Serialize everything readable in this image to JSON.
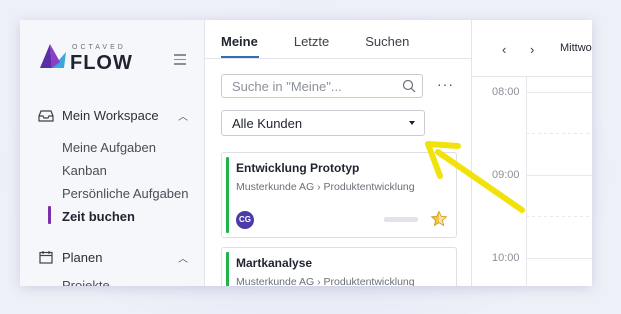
{
  "brand": {
    "tagline": "OCTAVED",
    "name": "FLOW",
    "colors": {
      "accent": "#7b2fa8",
      "logo_left": "#5b2ea6",
      "logo_right": "#3aa7e0"
    }
  },
  "sidebar": {
    "workspace_label": "Mein Workspace",
    "items": [
      {
        "label": "Meine Aufgaben"
      },
      {
        "label": "Kanban"
      },
      {
        "label": "Persönliche Aufgaben"
      },
      {
        "label": "Zeit buchen",
        "active": true
      }
    ],
    "plan_label": "Planen",
    "cut_item": "Projekte"
  },
  "panel": {
    "tabs": [
      {
        "label": "Meine",
        "active": true
      },
      {
        "label": "Letzte"
      },
      {
        "label": "Suchen"
      }
    ],
    "search_placeholder": "Suche in \"Meine\"...",
    "filter_value": "Alle Kunden",
    "more_label": "···",
    "cards": [
      {
        "title": "Entwicklung Prototyp",
        "path": "Musterkunde AG › Produktentwicklung",
        "avatar": "CG",
        "progress": 0,
        "status_color": "#1fb34a"
      },
      {
        "title": "Martkanalyse",
        "path": "Musterkunde AG › Produktentwicklung",
        "status_color": "#1fb34a"
      }
    ]
  },
  "calendar": {
    "prev_label": "‹",
    "next_label": "›",
    "day_label": "Mittwoch",
    "times": [
      "08:00",
      "09:00",
      "10:00"
    ]
  },
  "annotation": {
    "arrow_color": "#f2e20c"
  }
}
